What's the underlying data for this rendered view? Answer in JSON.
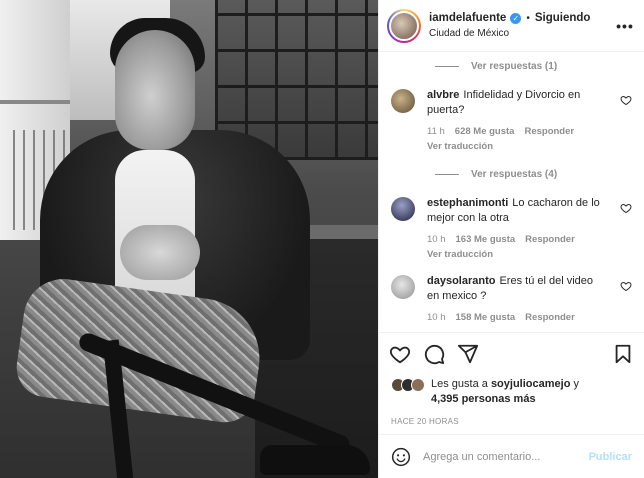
{
  "header": {
    "username": "iamdelafuente",
    "verified_glyph": "✓",
    "follow_state": "Siguiendo",
    "location": "Ciudad de México",
    "more_glyph": "•••"
  },
  "replies_1": "Ver respuestas (1)",
  "comments": [
    {
      "user": "alvbre",
      "text": "Infidelidad y Divorcio en puerta?",
      "time": "11 h",
      "likes": "628 Me gusta",
      "reply": "Responder",
      "translate": "Ver traducción",
      "avatar_color": "#8a7a5c"
    },
    {
      "user": "estephanimonti",
      "text": "Lo cacharon de lo mejor con la otra",
      "time": "10 h",
      "likes": "163 Me gusta",
      "reply": "Responder",
      "translate": "Ver traducción",
      "avatar_color": "#3a3c5a"
    },
    {
      "user": "daysolaranto",
      "text": "Eres tú el del video en mexico ?",
      "time": "10 h",
      "likes": "158 Me gusta",
      "reply": "Responder",
      "avatar_color": "#b9b9b9"
    }
  ],
  "replies_4": "Ver respuestas (4)",
  "likes": {
    "prefix": "Les gusta a ",
    "user": "soyjuliocamejo",
    "joiner": " y",
    "count": "4,395 personas más"
  },
  "timestamp": "HACE 20 HORAS",
  "add_comment": {
    "placeholder": "Agrega un comentario...",
    "publish": "Publicar"
  },
  "icons": [
    "heart-icon",
    "comment-icon",
    "share-icon",
    "bookmark-icon",
    "emoji-icon"
  ],
  "colors": {
    "accent": "#0095f6",
    "publish_disabled": "#b2dffc",
    "verified": "#3897f0",
    "muted": "#8e8e8e"
  }
}
